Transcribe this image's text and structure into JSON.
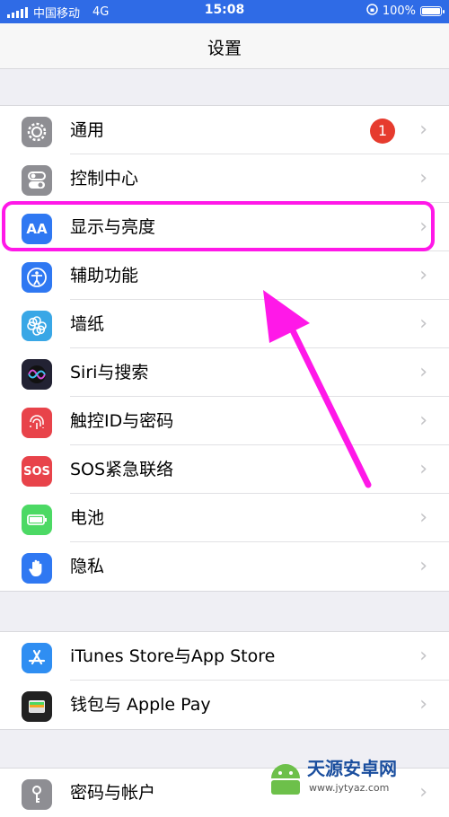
{
  "status_bar": {
    "carrier": "中国移动",
    "network": "4G",
    "time": "15:08",
    "battery_percent": "100%",
    "battery_level": 1.0
  },
  "nav": {
    "title": "设置"
  },
  "group1": [
    {
      "label": "通用",
      "icon": "gear-icon",
      "color": "#8e8e93",
      "badge": "1"
    },
    {
      "label": "控制中心",
      "icon": "toggle-switches-icon",
      "color": "#8e8e93"
    },
    {
      "label": "显示与亮度",
      "icon": "text-size-icon",
      "icon_text": "AA",
      "color": "#2f78f2"
    },
    {
      "label": "辅助功能",
      "icon": "accessibility-icon",
      "color": "#2f78f2"
    },
    {
      "label": "墙纸",
      "icon": "flower-icon",
      "color": "#39a7e6"
    },
    {
      "label": "Siri与搜索",
      "icon": "siri-icon",
      "color": "#222233"
    },
    {
      "label": "触控ID与密码",
      "icon": "fingerprint-icon",
      "color": "#e8434a"
    },
    {
      "label": "SOS紧急联络",
      "icon": "sos-icon",
      "icon_text": "SOS",
      "color": "#e8434a"
    },
    {
      "label": "电池",
      "icon": "battery-icon",
      "color": "#4cd964"
    },
    {
      "label": "隐私",
      "icon": "hand-icon",
      "color": "#2f78f2"
    }
  ],
  "group2": [
    {
      "label": "iTunes Store与App Store",
      "icon": "app-store-icon",
      "color": "#2f8ef2"
    },
    {
      "label": "钱包与 Apple Pay",
      "icon": "wallet-icon",
      "color": "#222222"
    }
  ],
  "group3": [
    {
      "label": "密码与帐户",
      "icon": "key-icon",
      "color": "#8e8e93"
    }
  ],
  "chevron": "›",
  "watermark": {
    "title": "天源安卓网",
    "url": "www.jytyaz.com"
  },
  "annotation_color": "#ff18e8"
}
